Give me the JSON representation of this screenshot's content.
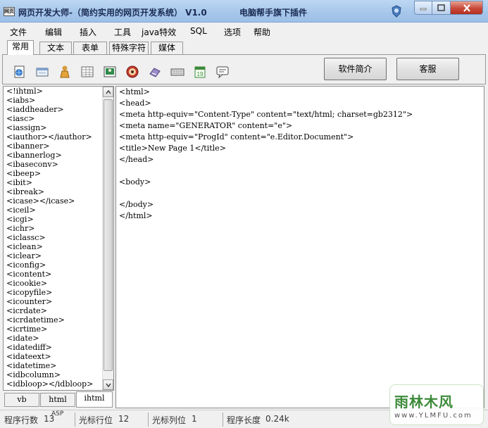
{
  "window": {
    "title": "网页开发大师-（简约实用的网页开发系统） V1.0",
    "plugin_label": "电脑帮手旗下插件",
    "app_icon_text": "网页"
  },
  "menu": [
    "文件",
    "编辑",
    "插入",
    "工具",
    "java特效",
    "SQL",
    "选项",
    "帮助"
  ],
  "tabs": [
    {
      "label": "常用",
      "active": true
    },
    {
      "label": "文本",
      "active": false
    },
    {
      "label": "表单",
      "active": false
    },
    {
      "label": "特殊字符",
      "active": false
    },
    {
      "label": "媒体",
      "active": false
    }
  ],
  "toolbar": {
    "icons": [
      "html-page-icon",
      "frame-icon",
      "person-icon",
      "table-grid-icon",
      "image-icon",
      "media-disc-icon",
      "link-icon",
      "keyboard-icon",
      "calendar-icon",
      "comment-icon"
    ],
    "calendar_day": "19",
    "intro_button": "软件简介",
    "service_button": "客服"
  },
  "tag_list": [
    "<!ihtml>",
    "<iabs>",
    "<iaddheader>",
    "<iasc>",
    "<iassign>",
    "<iauthor></iauthor>",
    "<ibanner>",
    "<ibannerlog>",
    "<ibaseconv>",
    "<ibeep>",
    "<ibit>",
    "<ibreak>",
    "<icase></icase>",
    "<iceil>",
    "<icgi>",
    "<ichr>",
    "<iclassc>",
    "<iclean>",
    "<iclear>",
    "<iconfig>",
    "<icontent>",
    "<icookie>",
    "<icopyfile>",
    "<icounter>",
    "<icrdate>",
    "<icrdatetime>",
    "<icrtime>",
    "<idate>",
    "<idatediff>",
    "<idateext>",
    "<idatetime>",
    "<idbcolumn>",
    "<idbloop></idbloop>"
  ],
  "list_tabs": [
    {
      "label": "vb",
      "active": false
    },
    {
      "label": "html",
      "active": false
    },
    {
      "label": "ihtml",
      "active": true
    }
  ],
  "editor_lines": [
    "<html>",
    "<head>",
    "<meta http-equiv=\"Content-Type\" content=\"text/html; charset=gb2312\">",
    "<meta name=\"GENERATOR\" content=\"e\">",
    "<meta http-equiv=\"ProgId\" content=\"e.Editor.Document\">",
    "<title>New Page 1</title>",
    "</head>",
    "",
    "<body>",
    "",
    "</body>",
    "</html>"
  ],
  "status": {
    "rows_label": "程序行数",
    "rows_value": "13",
    "cursor_row_label": "光标行位",
    "cursor_row_value": "12",
    "cursor_col_label": "光标列位",
    "cursor_col_value": "1",
    "length_label": "程序长度",
    "length_value": "0.24k",
    "mode_label": "ASP"
  },
  "watermark": {
    "text": "雨林木风",
    "url": "www.YLMFU.com"
  }
}
